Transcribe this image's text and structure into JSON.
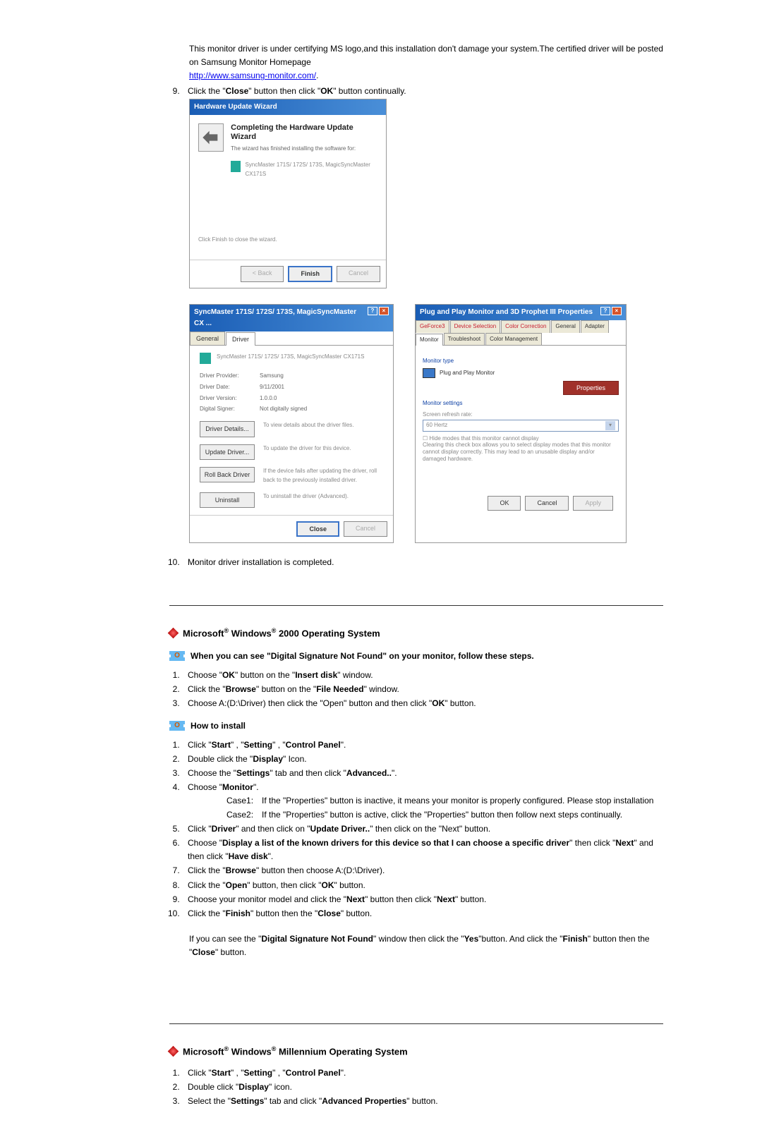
{
  "top": {
    "para_line1": "This monitor driver is under certifying MS logo,and this installation don't damage your system.The certified driver will be posted on Samsung Monitor Homepage",
    "url": "http://www.samsung-monitor.com/",
    "step9_before": "Click the \"",
    "close_word": "Close",
    "step9_mid": "\" button then click \"",
    "ok_word": "OK",
    "step9_after": "\" button continually."
  },
  "wiz1": {
    "title": "Hardware Update Wizard",
    "heading": "Completing the Hardware Update Wizard",
    "subtext": "The wizard has finished installing the software for:",
    "device": "SyncMaster 171S/ 172S/ 173S, MagicSyncMaster CX171S",
    "instr": "Click Finish to close the wizard.",
    "back": "< Back",
    "finish": "Finish",
    "cancel": "Cancel"
  },
  "dlg2": {
    "title": "SyncMaster 171S/ 172S/ 173S, MagicSyncMaster CX ...",
    "tab1": "General",
    "tab2": "Driver",
    "device": "SyncMaster 171S/ 172S/ 173S, MagicSyncMaster CX171S",
    "prov_lbl": "Driver Provider:",
    "prov": "Samsung",
    "date_lbl": "Driver Date:",
    "date": "9/11/2001",
    "ver_lbl": "Driver Version:",
    "ver": "1.0.0.0",
    "sign_lbl": "Digital Signer:",
    "sign": "Not digitally signed",
    "b_details": "Driver Details...",
    "d_details": "To view details about the driver files.",
    "b_update": "Update Driver...",
    "d_update": "To update the driver for this device.",
    "b_roll": "Roll Back Driver",
    "d_roll": "If the device fails after updating the driver, roll back to the previously installed driver.",
    "b_uninst": "Uninstall",
    "d_uninst": "To uninstall the driver (Advanced).",
    "close": "Close",
    "cancel": "Cancel"
  },
  "dlg3": {
    "title": "Plug and Play Monitor and 3D Prophet III Properties",
    "t_gen": "General",
    "t_ad": "Adapter",
    "t_mon": "Monitor",
    "t_tr": "Troubleshoot",
    "t_cm": "Color Management",
    "t_gf": "GeForce3",
    "t_ds": "Device Selection",
    "t_cc": "Color Correction",
    "g_montype": "Monitor type",
    "montype": "Plug and Play Monitor",
    "btn_prop": "Properties",
    "g_monset": "Monitor settings",
    "rr_lbl": "Screen refresh rate:",
    "rr": "60 Hertz",
    "chk": "Hide modes that this monitor cannot display",
    "chk_desc": "Clearing this check box allows you to select display modes that this monitor cannot display correctly. This may lead to an unusable display and/or damaged hardware.",
    "ok": "OK",
    "cancel": "Cancel",
    "apply": "Apply"
  },
  "completed_step": "Monitor driver installation is completed.",
  "w2000": {
    "heading_pre": "Microsoft",
    "heading_sup1": "®",
    "heading_mid": " Windows",
    "heading_sup2": "®",
    "heading_post": " 2000 Operating System",
    "sub1": "When you can see \"Digital Signature Not Found\" on your monitor, follow these steps.",
    "s1_a": "Choose \"",
    "s1_b": "OK",
    "s1_c": "\" button on the \"",
    "s1_d": "Insert disk",
    "s1_e": "\" window.",
    "s2_a": "Click the \"",
    "s2_b": "Browse",
    "s2_c": "\" button on the \"",
    "s2_d": "File Needed",
    "s2_e": "\" window.",
    "s3_a": "Choose A:(D:\\Driver) then click the \"Open\" button and then click \"",
    "s3_b": "OK",
    "s3_c": "\" button.",
    "sub2": "How to install",
    "i1_a": "Click \"",
    "i1_b": "Start",
    "i1_c": "\" , \"",
    "i1_d": "Setting",
    "i1_e": "\" , \"",
    "i1_f": "Control Panel",
    "i1_g": "\".",
    "i2_a": "Double click the \"",
    "i2_b": "Display",
    "i2_c": "\" Icon.",
    "i3_a": "Choose the \"",
    "i3_b": "Settings",
    "i3_c": "\" tab and then click \"",
    "i3_d": "Advanced..",
    "i3_e": "\".",
    "i4_a": "Choose \"",
    "i4_b": "Monitor",
    "i4_c": "\".",
    "case1_lbl": "Case1:",
    "case1": "If the \"Properties\" button is inactive, it means your monitor is properly configured. Please stop installation",
    "case2_lbl": "Case2:",
    "case2": "If the \"Properties\" button is active, click the \"Properties\" button then follow next steps continually.",
    "i5_a": "Click \"",
    "i5_b": "Driver",
    "i5_c": "\" and then click on \"",
    "i5_d": "Update Driver..",
    "i5_e": "\" then click on the \"Next\" button.",
    "i6_a": "Choose \"",
    "i6_b": "Display a list of the known drivers for this device so that I can choose a specific driver",
    "i6_c": "\" then click \"",
    "i6_d": "Next",
    "i6_e": "\" and then click \"",
    "i6_f": "Have disk",
    "i6_g": "\".",
    "i7_a": "Click the \"",
    "i7_b": "Browse",
    "i7_c": "\" button then choose A:(D:\\Driver).",
    "i8_a": "Click the \"",
    "i8_b": "Open",
    "i8_c": "\" button, then click \"",
    "i8_d": "OK",
    "i8_e": "\" button.",
    "i9_a": "Choose your monitor model and click the \"",
    "i9_b": "Next",
    "i9_c": "\" button then click \"",
    "i9_d": "Next",
    "i9_e": "\" button.",
    "i10_a": "Click the \"",
    "i10_b": "Finish",
    "i10_c": "\" button then the \"",
    "i10_d": "Close",
    "i10_e": "\" button.",
    "note_a": "If you can see the \"",
    "note_b": "Digital Signature Not Found",
    "note_c": "\" window then click the \"",
    "note_d": "Yes",
    "note_e": "\"button. And click the \"",
    "note_f": "Finish",
    "note_g": "\" button then the \"",
    "note_h": "Close",
    "note_i": "\" button."
  },
  "wme": {
    "heading_pre": "Microsoft",
    "heading_sup1": "®",
    "heading_mid": " Windows",
    "heading_sup2": "®",
    "heading_post": " Millennium Operating System",
    "s1_a": "Click \"",
    "s1_b": "Start",
    "s1_c": "\" , \"",
    "s1_d": "Setting",
    "s1_e": "\" , \"",
    "s1_f": "Control Panel",
    "s1_g": "\".",
    "s2_a": "Double click \"",
    "s2_b": "Display",
    "s2_c": "\" icon.",
    "s3_a": "Select the \"",
    "s3_b": "Settings",
    "s3_c": "\" tab and click \"",
    "s3_d": "Advanced Properties",
    "s3_e": "\" button."
  }
}
